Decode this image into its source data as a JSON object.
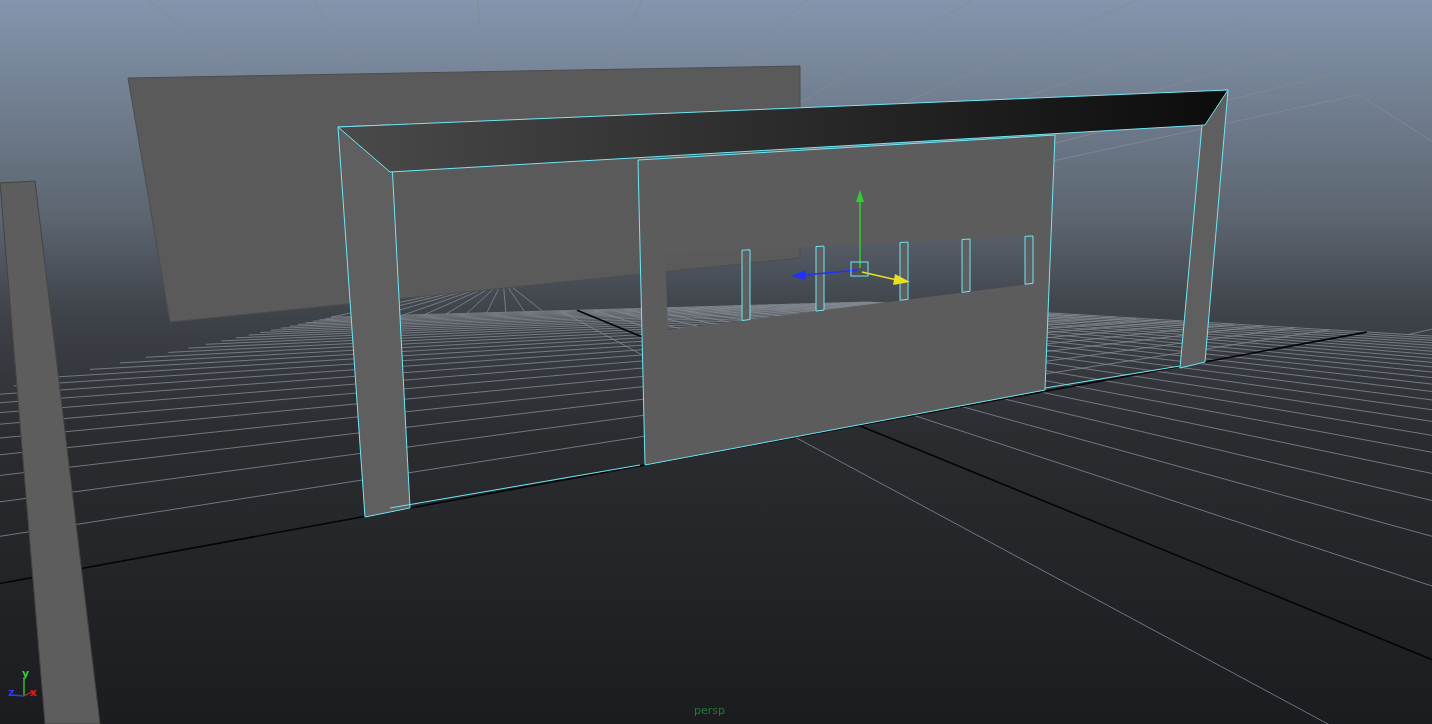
{
  "viewport": {
    "camera_label": "persp",
    "axis_labels": [
      {
        "text": "y",
        "color": "#3ccf3c"
      },
      {
        "text": "z",
        "color": "#2b3cff"
      },
      {
        "text": "x",
        "color": "#e02020"
      }
    ]
  }
}
